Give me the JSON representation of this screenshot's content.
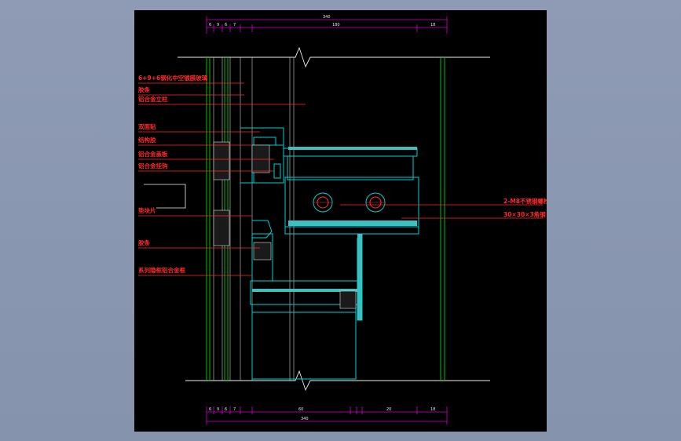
{
  "colors": {
    "background": "#8f9bb4",
    "viewport": "#000000",
    "label": "#ff2a2a",
    "profile": "#00d0d0",
    "glass": "#00c000",
    "dimension": "#d000d0",
    "fill": "#3fbfbf"
  },
  "labels": {
    "glass": "6+9+6钢化中空镀膜玻璃",
    "sealant": "胶条",
    "mullion": "铝合金立柱",
    "double_sided_tape": "双面贴",
    "structural_silicone": "结构胶",
    "aluminum_cover": "铝合金盖板",
    "aluminum_clip": "铝合金挂钩",
    "spacer": "垫块片",
    "gasket": "胶条",
    "transom": "系列隐框铝合金框",
    "bolt": "2-M8不锈钢螺栓",
    "angle_steel": "30×30×3角钢"
  },
  "dims_top": {
    "total": "340",
    "d1": "6",
    "d2": "9",
    "d3": "6",
    "d4": "7",
    "d5": "180",
    "d6": "18"
  },
  "dims_bottom": {
    "total": "340",
    "d1": "6",
    "d2": "9",
    "d3": "6",
    "d4": "7",
    "d5": "60",
    "d6": "20",
    "d7": "18"
  }
}
